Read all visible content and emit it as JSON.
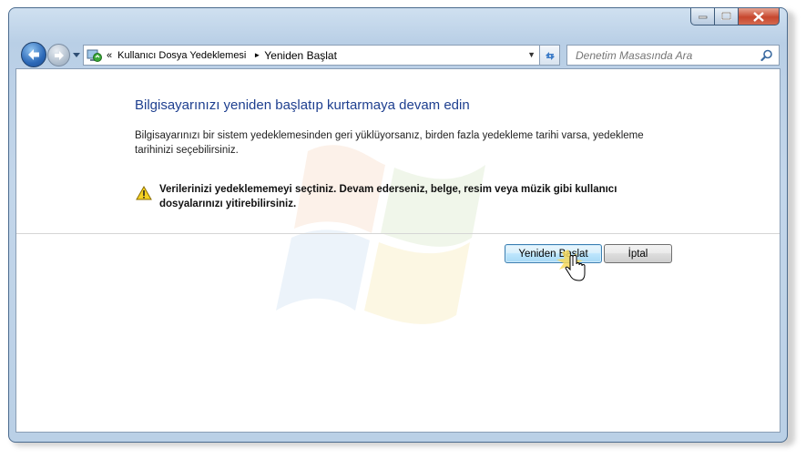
{
  "window": {
    "controls": {
      "minimize_icon": "minimize-icon",
      "maximize_icon": "maximize-icon",
      "close_icon": "close-icon"
    }
  },
  "navigation": {
    "back_icon": "back-arrow-icon",
    "forward_icon": "forward-arrow-icon",
    "recent_icon": "chevron-down-icon"
  },
  "address": {
    "overflow": "«",
    "crumbs": [
      "Kullanıcı Dosya Yedeklemesi",
      "Yeniden Başlat"
    ],
    "separator": "►",
    "icon": "backup-restore-icon"
  },
  "search": {
    "placeholder": "Denetim Masasında Ara",
    "icon": "search-icon"
  },
  "content": {
    "heading": "Bilgisayarınızı yeniden başlatıp kurtarmaya devam edin",
    "description": "Bilgisayarınızı bir sistem yedeklemesinden geri yüklüyorsanız, birden fazla yedekleme tarihi varsa, yedekleme tarihinizi seçebilirsiniz.",
    "warning": "Verilerinizi yedeklememeyi seçtiniz. Devam ederseniz, belge, resim veya müzik gibi kullanıcı dosyalarınızı yitirebilirsiniz.",
    "warning_icon": "warning-icon"
  },
  "buttons": {
    "restart": "Yeniden Başlat",
    "cancel": "İptal"
  },
  "colors": {
    "heading": "#1e3f8f",
    "frame": "#b9cfe6",
    "close_button": "#c7472e"
  }
}
